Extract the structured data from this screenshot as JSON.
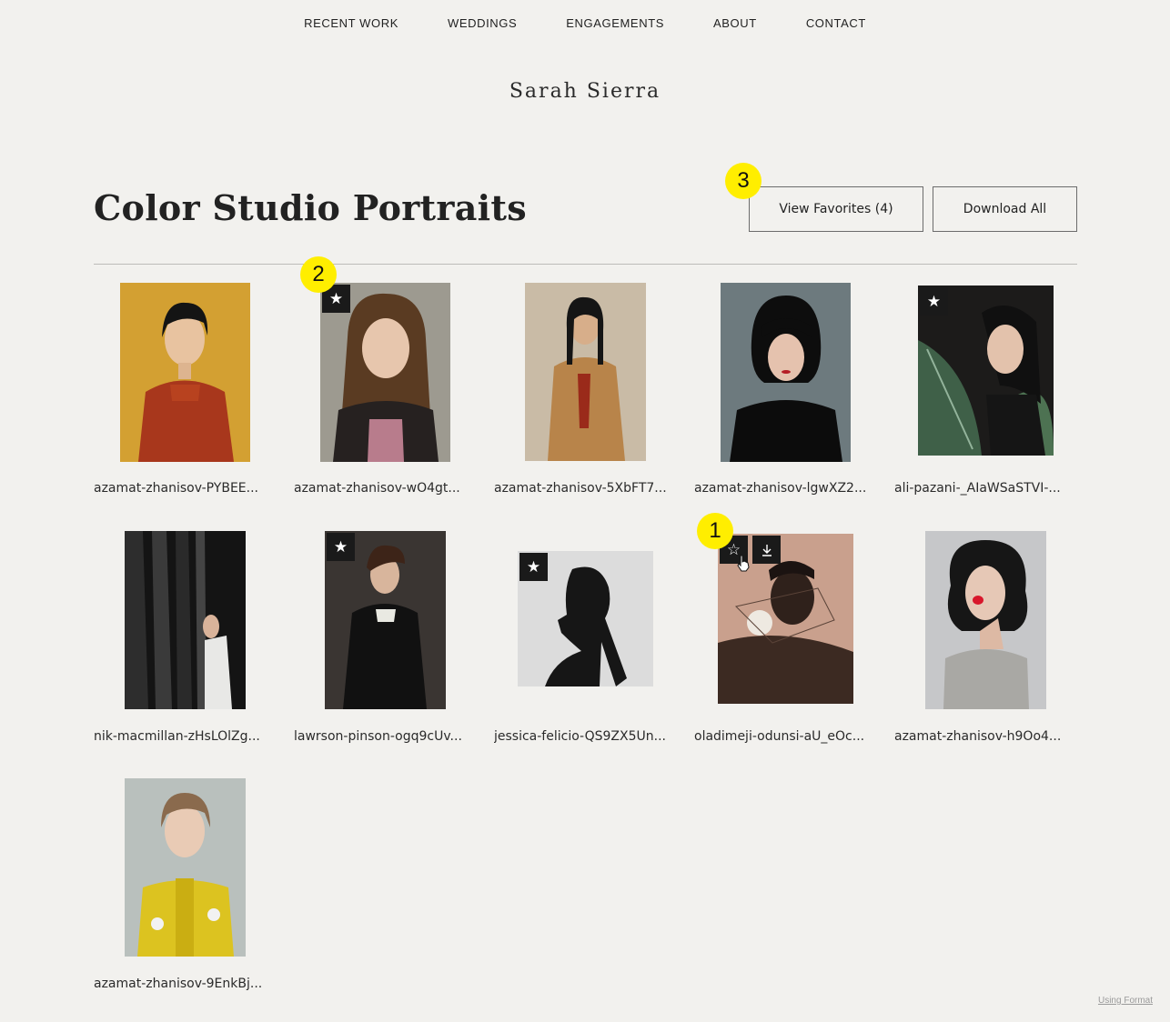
{
  "nav": {
    "items": [
      "RECENT WORK",
      "WEDDINGS",
      "ENGAGEMENTS",
      "ABOUT",
      "CONTACT"
    ]
  },
  "brand": "Sarah Sierra",
  "gallery": {
    "title": "Color Studio Portraits",
    "view_favorites_label": "View Favorites (4)",
    "download_all_label": "Download All"
  },
  "photos": [
    {
      "caption": "azamat-zhanisov-PYBEE...",
      "favorited": false
    },
    {
      "caption": "azamat-zhanisov-wO4gt...",
      "favorited": true
    },
    {
      "caption": "azamat-zhanisov-5XbFT7...",
      "favorited": false
    },
    {
      "caption": "azamat-zhanisov-lgwXZ2...",
      "favorited": false
    },
    {
      "caption": "ali-pazani-_AIaWSaSTVI-...",
      "favorited": true
    },
    {
      "caption": "nik-macmillan-zHsLOlZg...",
      "favorited": false
    },
    {
      "caption": "lawrson-pinson-ogq9cUv...",
      "favorited": true
    },
    {
      "caption": "jessica-felicio-QS9ZX5Un...",
      "favorited": true
    },
    {
      "caption": "oladimeji-odunsi-aU_eOc...",
      "favorited": false,
      "hovered": true
    },
    {
      "caption": "azamat-zhanisov-h9Oo4...",
      "favorited": false
    },
    {
      "caption": "azamat-zhanisov-9EnkBj...",
      "favorited": false
    }
  ],
  "icons": {
    "star_filled": "★",
    "star_outline": "☆"
  },
  "markers": [
    "1",
    "2",
    "3"
  ],
  "footer": "Using Format"
}
